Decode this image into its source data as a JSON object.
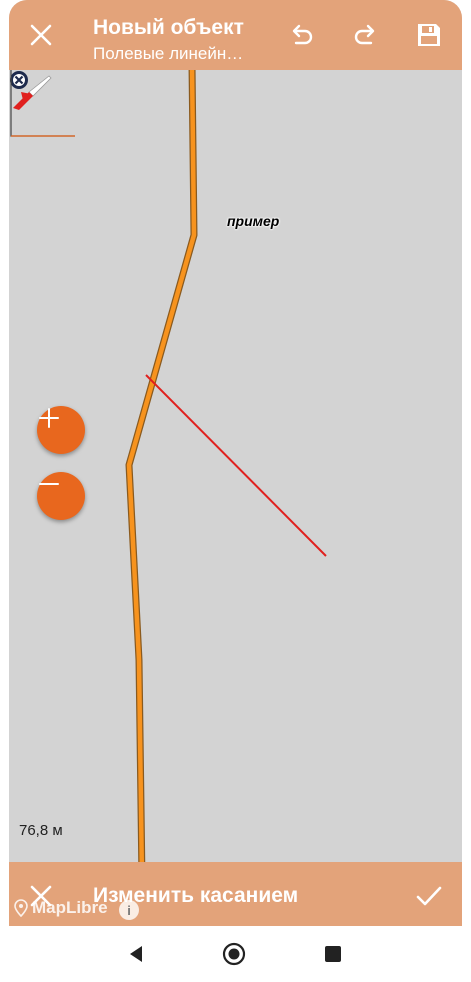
{
  "header": {
    "title": "Новый объект",
    "subtitle": "Полевые линейн…",
    "close_icon": "close-icon",
    "undo_icon": "undo-icon",
    "redo_icon": "redo-icon",
    "save_icon": "save-icon"
  },
  "map": {
    "poi_label": "пример",
    "scale_label": "76,8 м",
    "zoom_in_icon": "plus-icon",
    "zoom_out_icon": "minus-icon"
  },
  "action_bar": {
    "label": "Изменить касанием",
    "cancel_icon": "close-icon",
    "confirm_icon": "check-icon",
    "attribution": "MapLibre",
    "attribution_icon": "info-icon"
  },
  "colors": {
    "toolbar": "#e3a37a",
    "accent": "#e8671e",
    "map_background": "#d3d3d3",
    "road": "#f7931e",
    "drawn_line": "#e0201e"
  },
  "nav": {
    "back_icon": "back-icon",
    "home_icon": "home-icon",
    "recents_icon": "recents-icon"
  }
}
